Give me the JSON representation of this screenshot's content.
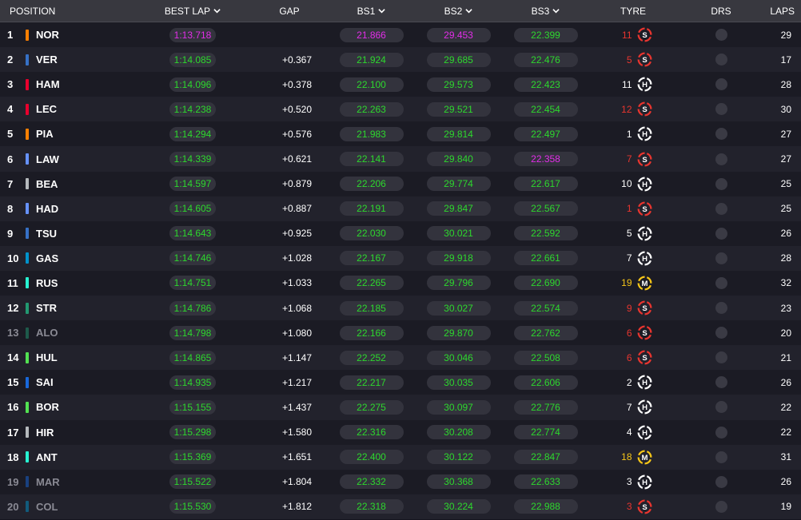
{
  "headers": {
    "position": "POSITION",
    "best_lap": "BEST LAP",
    "gap": "GAP",
    "bs1": "BS1",
    "bs2": "BS2",
    "bs3": "BS3",
    "tyre": "TYRE",
    "drs": "DRS",
    "laps": "LAPS"
  },
  "colors": {
    "green": "#2dd82d",
    "purple": "#e22de8",
    "soft": "#e8352f",
    "medium": "#f5c518",
    "hard": "#ffffff"
  },
  "rows": [
    {
      "pos": "1",
      "driver": "NOR",
      "team_color": "#ff8000",
      "best_lap": "1:13.718",
      "best_color": "purple",
      "gap": "",
      "bs1": "21.866",
      "bs1_color": "purple",
      "bs2": "29.453",
      "bs2_color": "purple",
      "bs3": "22.399",
      "bs3_color": "green",
      "tyre_age": "11",
      "tyre": "S",
      "laps": "29",
      "dim": false
    },
    {
      "pos": "2",
      "driver": "VER",
      "team_color": "#3671c6",
      "best_lap": "1:14.085",
      "best_color": "green",
      "gap": "+0.367",
      "bs1": "21.924",
      "bs1_color": "green",
      "bs2": "29.685",
      "bs2_color": "green",
      "bs3": "22.476",
      "bs3_color": "green",
      "tyre_age": "5",
      "tyre": "S",
      "laps": "17",
      "dim": false
    },
    {
      "pos": "3",
      "driver": "HAM",
      "team_color": "#e8002d",
      "best_lap": "1:14.096",
      "best_color": "green",
      "gap": "+0.378",
      "bs1": "22.100",
      "bs1_color": "green",
      "bs2": "29.573",
      "bs2_color": "green",
      "bs3": "22.423",
      "bs3_color": "green",
      "tyre_age": "11",
      "tyre": "H",
      "laps": "28",
      "dim": false
    },
    {
      "pos": "4",
      "driver": "LEC",
      "team_color": "#e8002d",
      "best_lap": "1:14.238",
      "best_color": "green",
      "gap": "+0.520",
      "bs1": "22.263",
      "bs1_color": "green",
      "bs2": "29.521",
      "bs2_color": "green",
      "bs3": "22.454",
      "bs3_color": "green",
      "tyre_age": "12",
      "tyre": "S",
      "laps": "30",
      "dim": false
    },
    {
      "pos": "5",
      "driver": "PIA",
      "team_color": "#ff8000",
      "best_lap": "1:14.294",
      "best_color": "green",
      "gap": "+0.576",
      "bs1": "21.983",
      "bs1_color": "green",
      "bs2": "29.814",
      "bs2_color": "green",
      "bs3": "22.497",
      "bs3_color": "green",
      "tyre_age": "1",
      "tyre": "H",
      "laps": "27",
      "dim": false
    },
    {
      "pos": "6",
      "driver": "LAW",
      "team_color": "#6692ff",
      "best_lap": "1:14.339",
      "best_color": "green",
      "gap": "+0.621",
      "bs1": "22.141",
      "bs1_color": "green",
      "bs2": "29.840",
      "bs2_color": "green",
      "bs3": "22.358",
      "bs3_color": "purple",
      "tyre_age": "7",
      "tyre": "S",
      "laps": "27",
      "dim": false
    },
    {
      "pos": "7",
      "driver": "BEA",
      "team_color": "#b6babd",
      "best_lap": "1:14.597",
      "best_color": "green",
      "gap": "+0.879",
      "bs1": "22.206",
      "bs1_color": "green",
      "bs2": "29.774",
      "bs2_color": "green",
      "bs3": "22.617",
      "bs3_color": "green",
      "tyre_age": "10",
      "tyre": "H",
      "laps": "25",
      "dim": false
    },
    {
      "pos": "8",
      "driver": "HAD",
      "team_color": "#6692ff",
      "best_lap": "1:14.605",
      "best_color": "green",
      "gap": "+0.887",
      "bs1": "22.191",
      "bs1_color": "green",
      "bs2": "29.847",
      "bs2_color": "green",
      "bs3": "22.567",
      "bs3_color": "green",
      "tyre_age": "1",
      "tyre": "S",
      "laps": "25",
      "dim": false
    },
    {
      "pos": "9",
      "driver": "TSU",
      "team_color": "#3671c6",
      "best_lap": "1:14.643",
      "best_color": "green",
      "gap": "+0.925",
      "bs1": "22.030",
      "bs1_color": "green",
      "bs2": "30.021",
      "bs2_color": "green",
      "bs3": "22.592",
      "bs3_color": "green",
      "tyre_age": "5",
      "tyre": "H",
      "laps": "26",
      "dim": false
    },
    {
      "pos": "10",
      "driver": "GAS",
      "team_color": "#0093cc",
      "best_lap": "1:14.746",
      "best_color": "green",
      "gap": "+1.028",
      "bs1": "22.167",
      "bs1_color": "green",
      "bs2": "29.918",
      "bs2_color": "green",
      "bs3": "22.661",
      "bs3_color": "green",
      "tyre_age": "7",
      "tyre": "H",
      "laps": "28",
      "dim": false
    },
    {
      "pos": "11",
      "driver": "RUS",
      "team_color": "#27f4d2",
      "best_lap": "1:14.751",
      "best_color": "green",
      "gap": "+1.033",
      "bs1": "22.265",
      "bs1_color": "green",
      "bs2": "29.796",
      "bs2_color": "green",
      "bs3": "22.690",
      "bs3_color": "green",
      "tyre_age": "19",
      "tyre": "M",
      "laps": "32",
      "dim": false
    },
    {
      "pos": "12",
      "driver": "STR",
      "team_color": "#229971",
      "best_lap": "1:14.786",
      "best_color": "green",
      "gap": "+1.068",
      "bs1": "22.185",
      "bs1_color": "green",
      "bs2": "30.027",
      "bs2_color": "green",
      "bs3": "22.574",
      "bs3_color": "green",
      "tyre_age": "9",
      "tyre": "S",
      "laps": "23",
      "dim": false
    },
    {
      "pos": "13",
      "driver": "ALO",
      "team_color": "#229971",
      "best_lap": "1:14.798",
      "best_color": "green",
      "gap": "+1.080",
      "bs1": "22.166",
      "bs1_color": "green",
      "bs2": "29.870",
      "bs2_color": "green",
      "bs3": "22.762",
      "bs3_color": "green",
      "tyre_age": "6",
      "tyre": "S",
      "laps": "20",
      "dim": true
    },
    {
      "pos": "14",
      "driver": "HUL",
      "team_color": "#52e252",
      "best_lap": "1:14.865",
      "best_color": "green",
      "gap": "+1.147",
      "bs1": "22.252",
      "bs1_color": "green",
      "bs2": "30.046",
      "bs2_color": "green",
      "bs3": "22.508",
      "bs3_color": "green",
      "tyre_age": "6",
      "tyre": "S",
      "laps": "21",
      "dim": false
    },
    {
      "pos": "15",
      "driver": "SAI",
      "team_color": "#1868db",
      "best_lap": "1:14.935",
      "best_color": "green",
      "gap": "+1.217",
      "bs1": "22.217",
      "bs1_color": "green",
      "bs2": "30.035",
      "bs2_color": "green",
      "bs3": "22.606",
      "bs3_color": "green",
      "tyre_age": "2",
      "tyre": "H",
      "laps": "26",
      "dim": false
    },
    {
      "pos": "16",
      "driver": "BOR",
      "team_color": "#52e252",
      "best_lap": "1:15.155",
      "best_color": "green",
      "gap": "+1.437",
      "bs1": "22.275",
      "bs1_color": "green",
      "bs2": "30.097",
      "bs2_color": "green",
      "bs3": "22.776",
      "bs3_color": "green",
      "tyre_age": "7",
      "tyre": "H",
      "laps": "22",
      "dim": false
    },
    {
      "pos": "17",
      "driver": "HIR",
      "team_color": "#b6babd",
      "best_lap": "1:15.298",
      "best_color": "green",
      "gap": "+1.580",
      "bs1": "22.316",
      "bs1_color": "green",
      "bs2": "30.208",
      "bs2_color": "green",
      "bs3": "22.774",
      "bs3_color": "green",
      "tyre_age": "4",
      "tyre": "H",
      "laps": "22",
      "dim": false
    },
    {
      "pos": "18",
      "driver": "ANT",
      "team_color": "#27f4d2",
      "best_lap": "1:15.369",
      "best_color": "green",
      "gap": "+1.651",
      "bs1": "22.400",
      "bs1_color": "green",
      "bs2": "30.122",
      "bs2_color": "green",
      "bs3": "22.847",
      "bs3_color": "green",
      "tyre_age": "18",
      "tyre": "M",
      "laps": "31",
      "dim": false
    },
    {
      "pos": "19",
      "driver": "MAR",
      "team_color": "#1868db",
      "best_lap": "1:15.522",
      "best_color": "green",
      "gap": "+1.804",
      "bs1": "22.332",
      "bs1_color": "green",
      "bs2": "30.368",
      "bs2_color": "green",
      "bs3": "22.633",
      "bs3_color": "green",
      "tyre_age": "3",
      "tyre": "H",
      "laps": "26",
      "dim": true
    },
    {
      "pos": "20",
      "driver": "COL",
      "team_color": "#0093cc",
      "best_lap": "1:15.530",
      "best_color": "green",
      "gap": "+1.812",
      "bs1": "22.318",
      "bs1_color": "green",
      "bs2": "30.224",
      "bs2_color": "green",
      "bs3": "22.988",
      "bs3_color": "green",
      "tyre_age": "3",
      "tyre": "S",
      "laps": "19",
      "dim": true
    }
  ]
}
